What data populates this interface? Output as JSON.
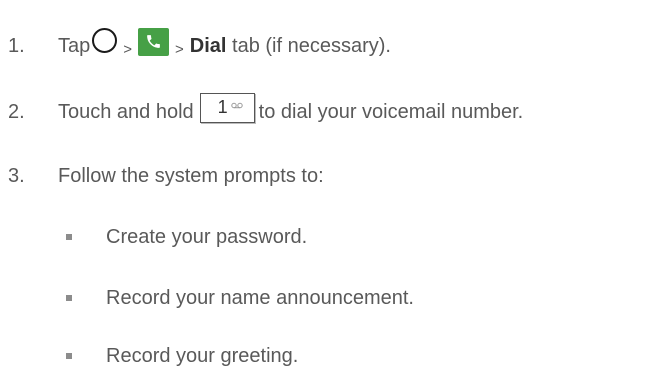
{
  "steps": [
    {
      "number": "1.",
      "text_tap": "Tap",
      "sep1": ">",
      "sep2": ">",
      "dial_label": "Dial",
      "after_dial": " tab (if necessary)."
    },
    {
      "number": "2.",
      "text_before": "Touch and hold",
      "key_digit": "1",
      "text_after": "to dial your voicemail number."
    },
    {
      "number": "3.",
      "text": "Follow the system prompts to:"
    }
  ],
  "sub_steps": [
    "Create your password.",
    "Record your name announcement.",
    "Record your greeting."
  ],
  "icons": {
    "home": "home-circle-icon",
    "phone": "phone-app-icon",
    "voicemail": "voicemail-icon"
  },
  "colors": {
    "text": "#595959",
    "phone_tile": "#46a046"
  }
}
